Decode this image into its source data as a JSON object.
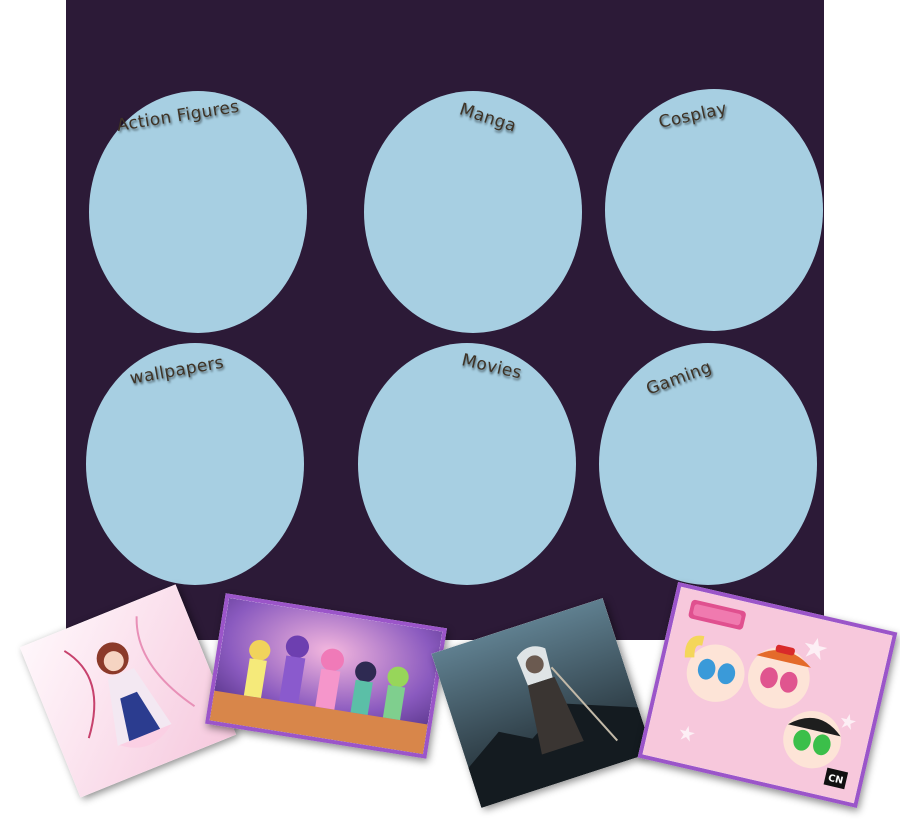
{
  "categories": [
    {
      "label": "Action Figures"
    },
    {
      "label": "Manga"
    },
    {
      "label": "Cosplay"
    },
    {
      "label": "wallpapers"
    },
    {
      "label": "Movies"
    },
    {
      "label": "Gaming"
    }
  ],
  "photos": [
    {
      "name": "pink-anime-girl-image"
    },
    {
      "name": "mew-mew-group-image"
    },
    {
      "name": "dark-warrior-image"
    },
    {
      "name": "powerpuff-girls-image",
      "logo_text": "CN"
    }
  ],
  "colors": {
    "panel": "#2c1a37",
    "circle": "#a7cfe2",
    "label": "#3e3326",
    "photo_frame": "#9b55c9"
  }
}
